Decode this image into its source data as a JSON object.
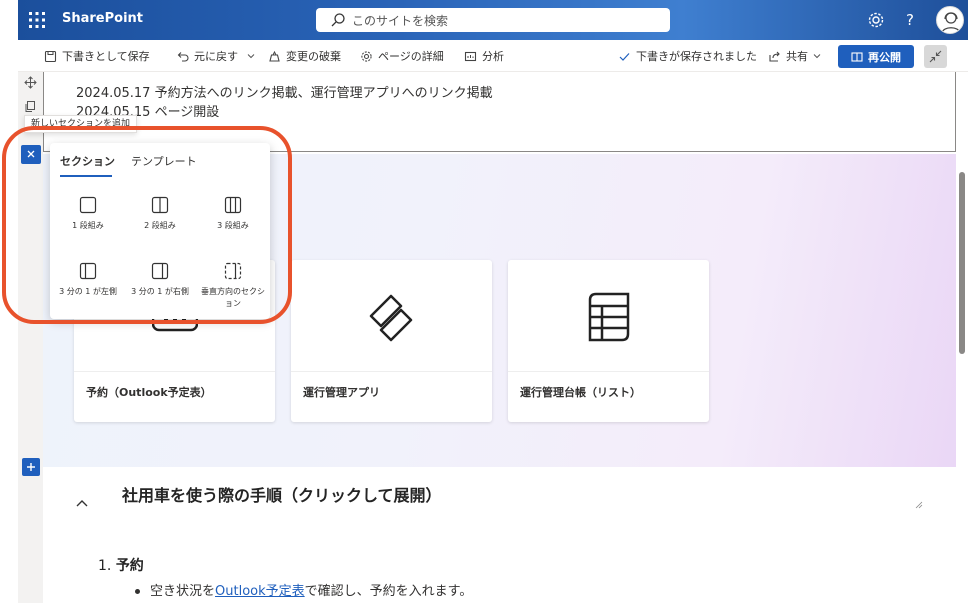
{
  "suitebar": {
    "brand": "SharePoint",
    "search_placeholder": "このサイトを検索"
  },
  "command_bar": {
    "save_draft": "下書きとして保存",
    "undo": "元に戻す",
    "discard": "変更の破棄",
    "page_details": "ページの詳細",
    "analytics": "分析",
    "draft_saved": "下書きが保存されました",
    "share": "共有",
    "republish": "再公開"
  },
  "text_section": {
    "line1": "2024.05.17 予約方法へのリンク掲載、運行管理アプリへのリンク掲載",
    "line2": "2024.05.15 ページ開設"
  },
  "tooltip": "新しいセクションを追加",
  "picker": {
    "tabs": [
      "セクション",
      "テンプレート"
    ],
    "options": [
      "1 段組み",
      "2 段組み",
      "3 段組み",
      "3 分の 1 が左側",
      "3 分の 1 が右側",
      "垂直方向のセクション"
    ]
  },
  "cards": [
    {
      "title": "予約（Outlook予定表）",
      "icon": "calendar-icon"
    },
    {
      "title": "運行管理アプリ",
      "icon": "power-apps-icon"
    },
    {
      "title": "運行管理台帳（リスト）",
      "icon": "list-table-icon"
    }
  ],
  "collapsible": {
    "heading": "社用車を使う際の手順（クリックして展開）",
    "step_number": "1.",
    "step_title": "予約",
    "bullet_before": "空き状況を",
    "bullet_link": "Outlook予定表",
    "bullet_after": "で確認し、予約を入れます。"
  },
  "colors": {
    "brand_blue": "#1f5fbd",
    "highlight_orange": "#e8522c"
  }
}
